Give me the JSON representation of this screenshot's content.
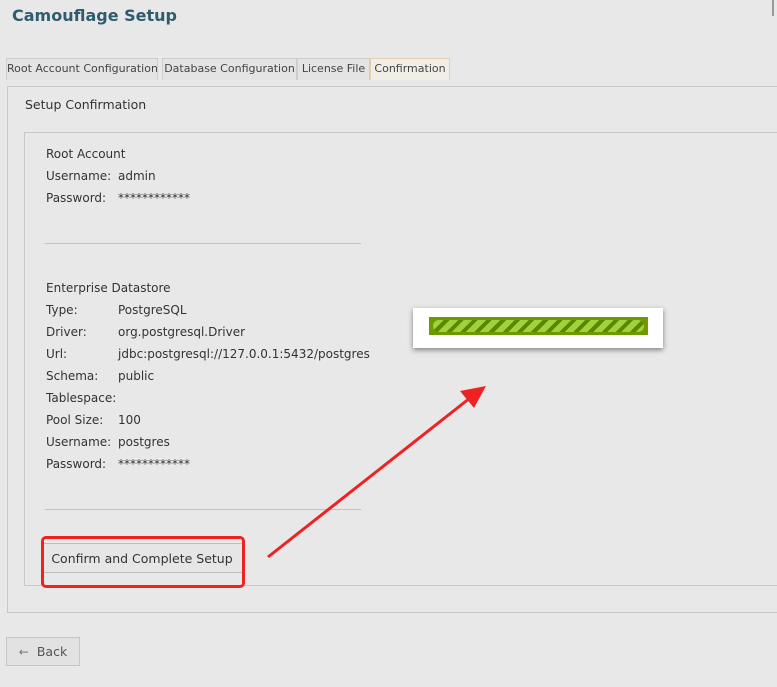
{
  "app": {
    "title": "Camouflage Setup"
  },
  "tabs": [
    {
      "label": "Root Account Configuration"
    },
    {
      "label": "Database Configuration"
    },
    {
      "label": "License File"
    },
    {
      "label": "Confirmation",
      "active": true
    }
  ],
  "panel": {
    "title": "Setup Confirmation"
  },
  "root_account": {
    "title": "Root Account",
    "fields": [
      {
        "label": "Username:",
        "value": "admin"
      },
      {
        "label": "Password:",
        "value": "************"
      }
    ]
  },
  "datastore": {
    "title": "Enterprise Datastore",
    "fields": [
      {
        "label": "Type:",
        "value": "PostgreSQL"
      },
      {
        "label": "Driver:",
        "value": "org.postgresql.Driver"
      },
      {
        "label": "Url:",
        "value": "jdbc:postgresql://127.0.0.1:5432/postgres"
      },
      {
        "label": "Schema:",
        "value": "public"
      },
      {
        "label": "Tablespace:",
        "value": ""
      },
      {
        "label": "Pool Size:",
        "value": "100"
      },
      {
        "label": "Username:",
        "value": "postgres"
      },
      {
        "label": "Password:",
        "value": "************"
      }
    ]
  },
  "actions": {
    "confirm_label": "Confirm and Complete Setup",
    "back_label": "Back",
    "back_icon": "arrow-left-icon"
  },
  "progress": {
    "state": "indeterminate",
    "bar_color": "#6e9a00",
    "stripe_color": "#9fd23b"
  },
  "annotation": {
    "color": "#ee2222"
  }
}
